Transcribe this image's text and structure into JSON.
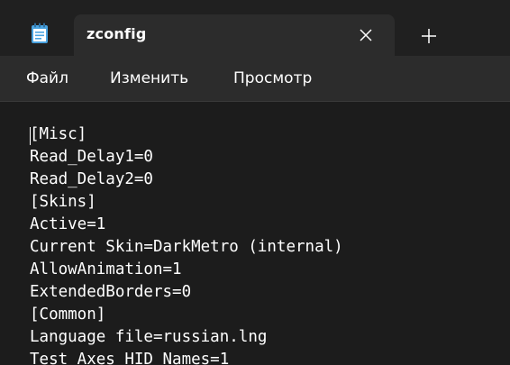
{
  "tab": {
    "title": "zconfig"
  },
  "menu": {
    "file": "Файл",
    "edit": "Изменить",
    "view": "Просмотр"
  },
  "editor": {
    "lines": [
      "[Misc]",
      "Read_Delay1=0",
      "Read_Delay2=0",
      "[Skins]",
      "Active=1",
      "Current Skin=DarkMetro (internal)",
      "AllowAnimation=1",
      "ExtendedBorders=0",
      "[Common]",
      "Language file=russian.lng",
      "Test Axes HID Names=1"
    ]
  },
  "icons": {
    "app": "notepad-icon",
    "close": "close-icon",
    "new_tab": "plus-icon"
  },
  "colors": {
    "background": "#1c1c1c",
    "tabstrip": "#202020",
    "active_tab": "#2c2c2c",
    "text": "#ffffff"
  }
}
